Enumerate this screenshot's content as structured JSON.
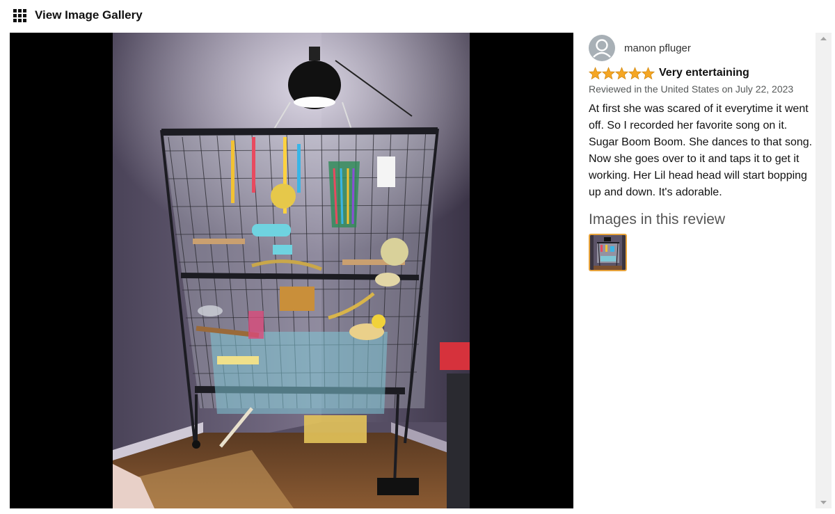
{
  "header": {
    "title": "View Image Gallery",
    "icon": "grid-icon"
  },
  "viewer": {
    "image_alt": "Bird cage with perches, swings and colorful toys under a heat lamp in a room corner"
  },
  "review": {
    "reviewer_name": "manon pfluger",
    "rating": 5,
    "rating_max": 5,
    "title": "Very entertaining",
    "meta": "Reviewed in the United States on July 22, 2023",
    "body": "At first she was scared of it everytime it went off. So I recorded her favorite song on it. Sugar Boom Boom. She dances to that song. Now she goes over to it and taps it to get it working. Her Lil head head will start bopping up and down. It's adorable.",
    "images_heading": "Images in this review",
    "star_color": "#f5a623",
    "thumb_border_color": "#e8a33b"
  }
}
